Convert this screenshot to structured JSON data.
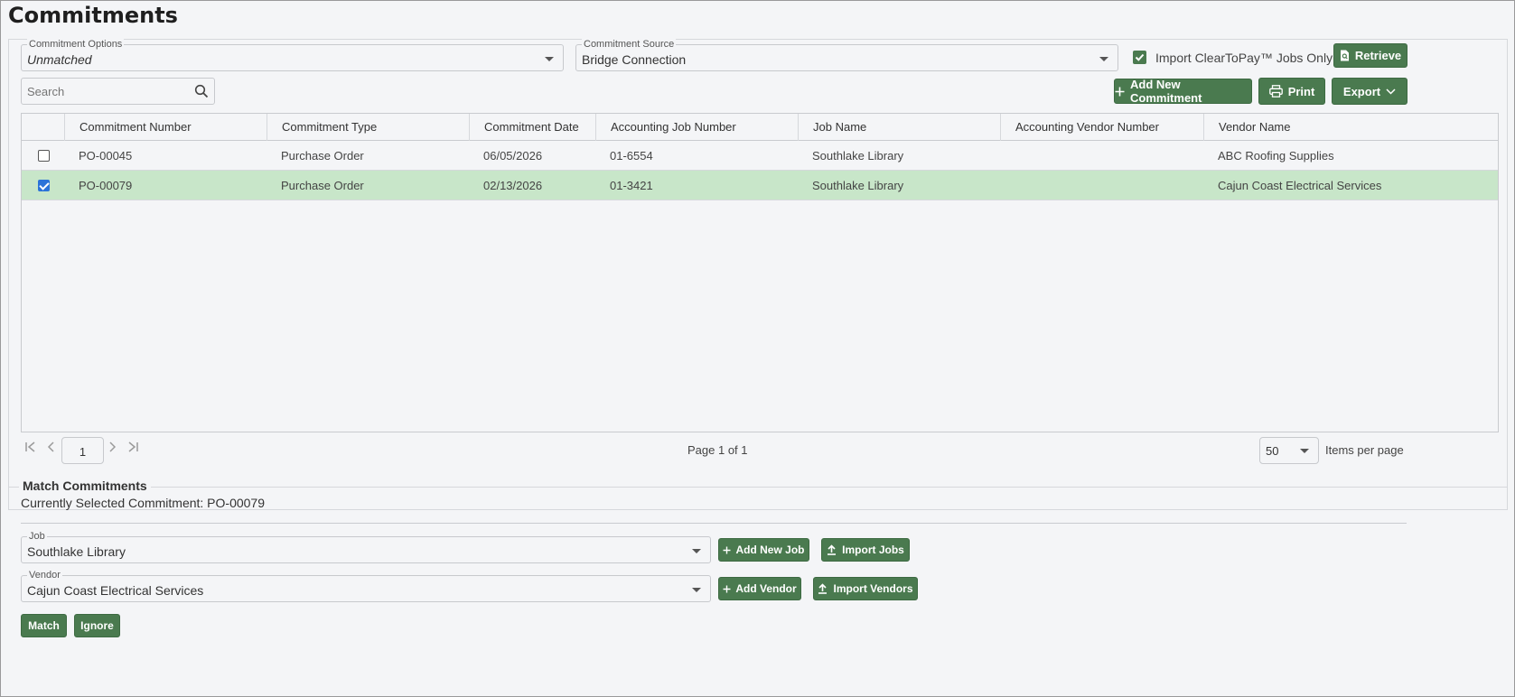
{
  "page": {
    "title": "Commitments"
  },
  "options": {
    "commitment_options_label": "Commitment Options",
    "commitment_options_value": "Unmatched",
    "commitment_source_label": "Commitment Source",
    "commitment_source_value": "Bridge Connection",
    "import_cleartopay_label": "Import ClearToPay™ Jobs Only",
    "import_cleartopay_checked": true,
    "retrieve_label": "Retrieve"
  },
  "search": {
    "placeholder": "Search"
  },
  "toolbar": {
    "add_new_commitment": "Add New Commitment",
    "print": "Print",
    "export": "Export"
  },
  "table": {
    "columns": [
      "Commitment Number",
      "Commitment Type",
      "Commitment Date",
      "Accounting Job Number",
      "Job Name",
      "Accounting Vendor Number",
      "Vendor Name"
    ],
    "rows": [
      {
        "selected": false,
        "number": "PO-00045",
        "type": "Purchase Order",
        "date": "06/05/2026",
        "job_number": "01-6554",
        "job_name": "Southlake Library",
        "vendor_number": "",
        "vendor_name": "ABC Roofing Supplies"
      },
      {
        "selected": true,
        "number": "PO-00079",
        "type": "Purchase Order",
        "date": "02/13/2026",
        "job_number": "01-3421",
        "job_name": "Southlake Library",
        "vendor_number": "",
        "vendor_name": "Cajun Coast Electrical Services"
      }
    ]
  },
  "pager": {
    "page_input": "1",
    "page_info": "Page 1 of 1",
    "items_per_page_value": "50",
    "items_per_page_label": "Items per page"
  },
  "match": {
    "section_title": "Match Commitments",
    "selected_label": "Currently Selected Commitment: PO-00079",
    "job_label": "Job",
    "job_value": "Southlake Library",
    "vendor_label": "Vendor",
    "vendor_value": "Cajun Coast Electrical Services",
    "add_new_job": "Add New Job",
    "import_jobs": "Import Jobs",
    "add_vendor": "Add Vendor",
    "import_vendors": "Import Vendors",
    "match_button": "Match",
    "ignore_button": "Ignore"
  },
  "colors": {
    "accent": "#4a7a4f",
    "selected_row": "#c8e6c9",
    "checkbox_blue": "#2b73d8"
  }
}
